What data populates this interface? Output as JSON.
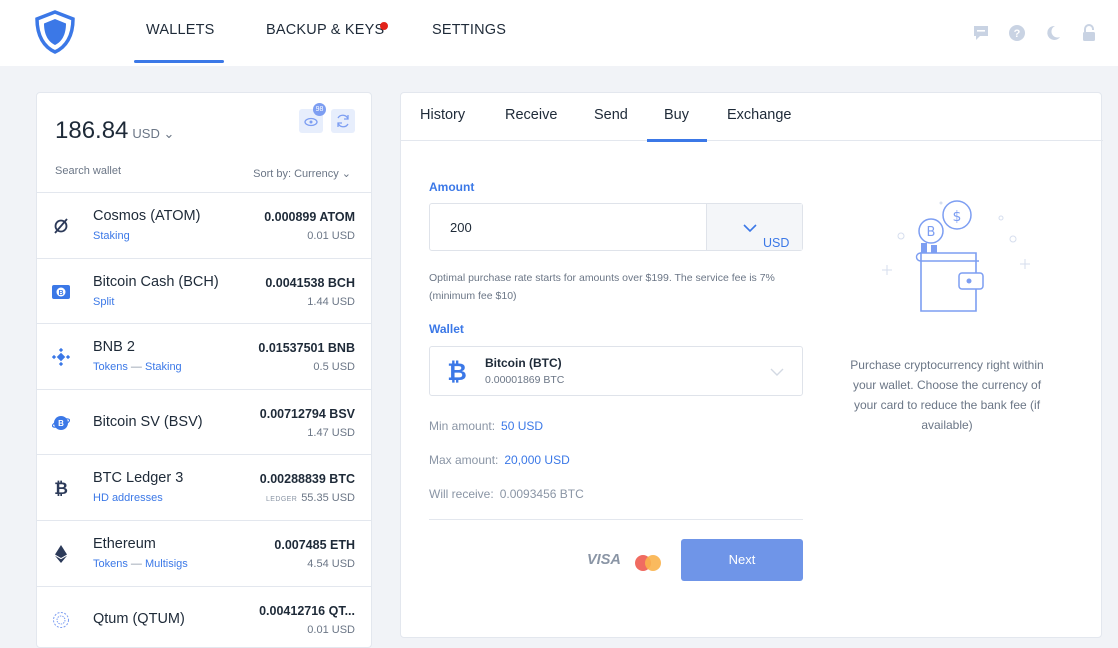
{
  "nav": {
    "tabs": [
      "WALLETS",
      "BACKUP & KEYS",
      "SETTINGS"
    ],
    "active": "WALLETS",
    "right_icons": [
      "chat-icon",
      "help-icon",
      "moon-icon",
      "lock-icon"
    ]
  },
  "colors": {
    "accent": "#3b78e7",
    "button": "#6f95e8",
    "notification": "#e2231a"
  },
  "left": {
    "balance": "186.84",
    "currency": "USD",
    "hidden_badge": "98",
    "search_placeholder": "Search wallet",
    "sort": "Sort by: Currency",
    "wallets": [
      {
        "name": "Cosmos (ATOM)",
        "tag": "Staking",
        "tag2": "",
        "amount": "0.000899 ATOM",
        "usd": "0.01 USD",
        "ledger": "",
        "icon": "cosmos-icon"
      },
      {
        "name": "Bitcoin Cash (BCH)",
        "tag": "Split",
        "tag2": "",
        "amount": "0.0041538 BCH",
        "usd": "1.44 USD",
        "ledger": "",
        "icon": "bitcoin-cash-icon"
      },
      {
        "name": "BNB 2",
        "tag": "Tokens",
        "tag2": "Staking",
        "amount": "0.01537501 BNB",
        "usd": "0.5 USD",
        "ledger": "",
        "icon": "bnb-icon"
      },
      {
        "name": "Bitcoin SV (BSV)",
        "tag": "",
        "tag2": "",
        "amount": "0.00712794 BSV",
        "usd": "1.47 USD",
        "ledger": "",
        "icon": "bitcoin-sv-icon"
      },
      {
        "name": "BTC Ledger 3",
        "tag": "HD addresses",
        "tag2": "",
        "amount": "0.00288839 BTC",
        "usd": "55.35 USD",
        "ledger": "LEDGER",
        "icon": "bitcoin-icon"
      },
      {
        "name": "Ethereum",
        "tag": "Tokens",
        "tag2": "Multisigs",
        "amount": "0.007485 ETH",
        "usd": "4.54 USD",
        "ledger": "",
        "icon": "ethereum-icon"
      },
      {
        "name": "Qtum (QTUM)",
        "tag": "",
        "tag2": "",
        "amount": "0.00412716 QT...",
        "usd": "0.01 USD",
        "ledger": "",
        "icon": "qtum-icon"
      }
    ]
  },
  "right": {
    "tabs": [
      "History",
      "Receive",
      "Send",
      "Buy",
      "Exchange"
    ],
    "active_tab": "Buy",
    "amount_label": "Amount",
    "amount_value": "200",
    "amount_currency": "USD",
    "hint": "Optimal purchase rate starts for amounts over $199. The service fee is 7% (minimum fee $10)",
    "wallet_label": "Wallet",
    "wallet_name": "Bitcoin (BTC)",
    "wallet_amount": "0.00001869 BTC",
    "min_label": "Min amount:",
    "min_value": "50 USD",
    "max_label": "Max amount:",
    "max_value": "20,000 USD",
    "receive_label": "Will receive:",
    "receive_value": "0.0093456 BTC",
    "visa": "VISA",
    "next": "Next",
    "promo": "Purchase cryptocurrency right within your wallet. Choose the currency of your card to reduce the bank fee (if available)"
  }
}
